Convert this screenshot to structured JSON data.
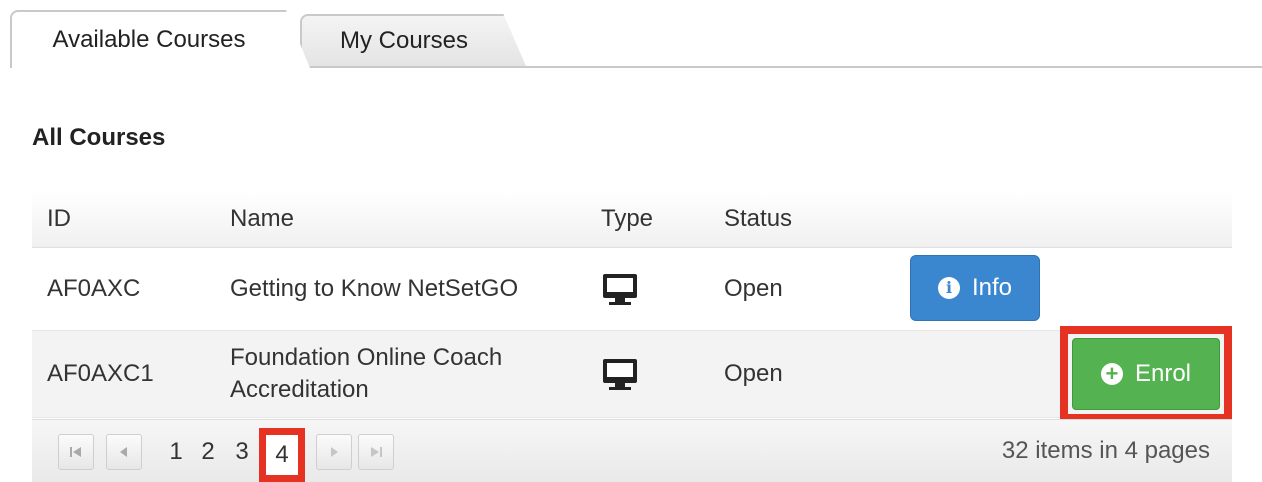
{
  "tabs": [
    {
      "label": "Available Courses",
      "active": true
    },
    {
      "label": "My Courses",
      "active": false
    }
  ],
  "section_title": "All Courses",
  "table": {
    "columns": [
      "ID",
      "Name",
      "Type",
      "Status",
      ""
    ],
    "rows": [
      {
        "id": "AF0AXC",
        "name": "Getting to Know NetSetGO",
        "type_icon": "monitor-icon",
        "status": "Open",
        "action": "Info"
      },
      {
        "id": "AF0AXC1",
        "name_line1": "Foundation Online Coach",
        "name_line2": "Accreditation",
        "type_icon": "monitor-icon",
        "status": "Open",
        "action": "Enrol"
      }
    ]
  },
  "pager": {
    "pages": [
      "1",
      "2",
      "3",
      "4"
    ],
    "current": "4",
    "info": "32 items in 4 pages"
  },
  "colors": {
    "info_button": "#3a87cf",
    "enrol_button": "#54b350",
    "highlight": "#e53222"
  }
}
